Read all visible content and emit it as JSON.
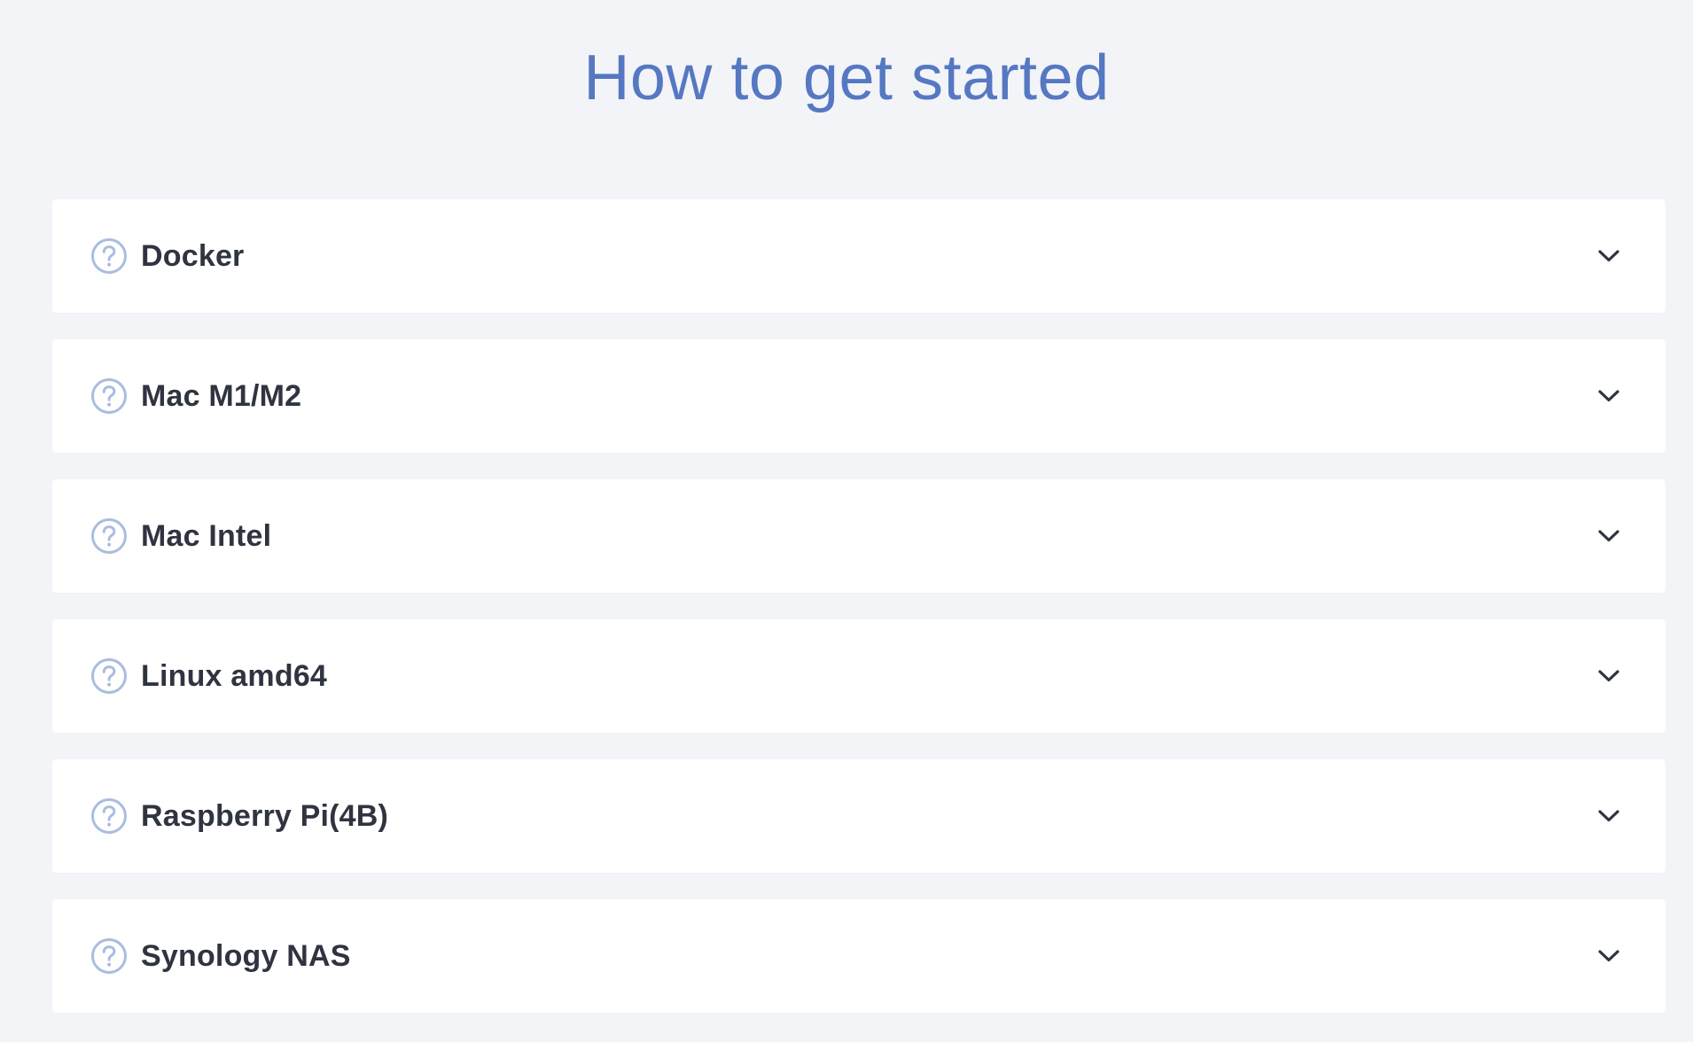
{
  "header": {
    "title": "How to get started"
  },
  "faq": {
    "items": [
      {
        "label": "Docker",
        "icon": "question-circle-icon",
        "toggle_icon": "chevron-down-icon"
      },
      {
        "label": "Mac M1/M2",
        "icon": "question-circle-icon",
        "toggle_icon": "chevron-down-icon"
      },
      {
        "label": "Mac Intel",
        "icon": "question-circle-icon",
        "toggle_icon": "chevron-down-icon"
      },
      {
        "label": "Linux amd64",
        "icon": "question-circle-icon",
        "toggle_icon": "chevron-down-icon"
      },
      {
        "label": "Raspberry Pi(4B)",
        "icon": "question-circle-icon",
        "toggle_icon": "chevron-down-icon"
      },
      {
        "label": "Synology NAS",
        "icon": "question-circle-icon",
        "toggle_icon": "chevron-down-icon"
      }
    ]
  },
  "colors": {
    "background": "#f3f4f8",
    "title": "#5678c2",
    "card": "#ffffff",
    "label": "#2f3440",
    "question_icon": "#a9bde0",
    "chevron": "#2f3440"
  }
}
